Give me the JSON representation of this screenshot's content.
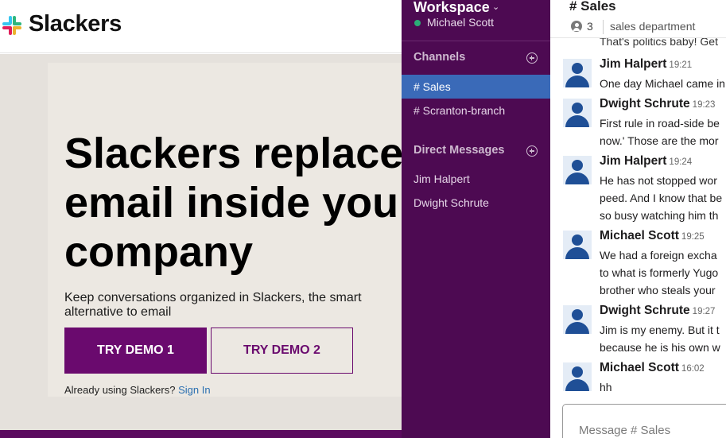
{
  "landing": {
    "logo_text": "Slackers",
    "hero": {
      "title_lines": [
        "Slackers replace",
        "email inside you",
        "company"
      ],
      "subtitle": "Keep conversations organized in Slackers, the smart alternative to email"
    },
    "buttons": {
      "demo1": "TRY DEMO 1",
      "demo2": "TRY DEMO 2"
    },
    "signin_prompt": "Already using Slackers?",
    "signin_link": "Sign In",
    "colors": {
      "brand": "#6a0a6e",
      "hero_bg": "#e5e1dc"
    }
  },
  "sidebar": {
    "workspace": "Workspace",
    "workspace_chevron": "⌄",
    "user": "Michael Scott",
    "channels_heading": "Channels",
    "channels": [
      {
        "label": "# Sales",
        "active": true
      },
      {
        "label": "# Scranton-branch",
        "active": false
      }
    ],
    "dm_heading": "Direct Messages",
    "direct_messages": [
      {
        "label": "Jim Halpert"
      },
      {
        "label": "Dwight Schrute"
      }
    ],
    "colors": {
      "bg": "#4d0a52",
      "active": "#3a6ab8",
      "online": "#2bac76"
    }
  },
  "chat": {
    "title": "# Sales",
    "member_count": "3",
    "description": "sales department",
    "previous_text": "That's politics baby! Get",
    "messages": [
      {
        "author": "Jim Halpert",
        "time": "19:21",
        "lines": [
          "One day Michael came in"
        ]
      },
      {
        "author": "Dwight Schrute",
        "time": "19:23",
        "lines": [
          "First rule in road-side be",
          "now.' Those are the mor"
        ]
      },
      {
        "author": "Jim Halpert",
        "time": "19:24",
        "lines": [
          "He has not stopped wor",
          "peed. And I know that be",
          "so busy watching him th"
        ]
      },
      {
        "author": "Michael Scott",
        "time": "19:25",
        "lines": [
          "We had a foreign excha",
          "to what is formerly Yugo",
          "brother who steals your"
        ]
      },
      {
        "author": "Dwight Schrute",
        "time": "19:27",
        "lines": [
          "Jim is my enemy. But it t",
          "because he is his own w"
        ]
      },
      {
        "author": "Michael Scott",
        "time": "16:02",
        "lines": [
          "hh"
        ]
      }
    ],
    "composer_placeholder": "Message # Sales"
  }
}
